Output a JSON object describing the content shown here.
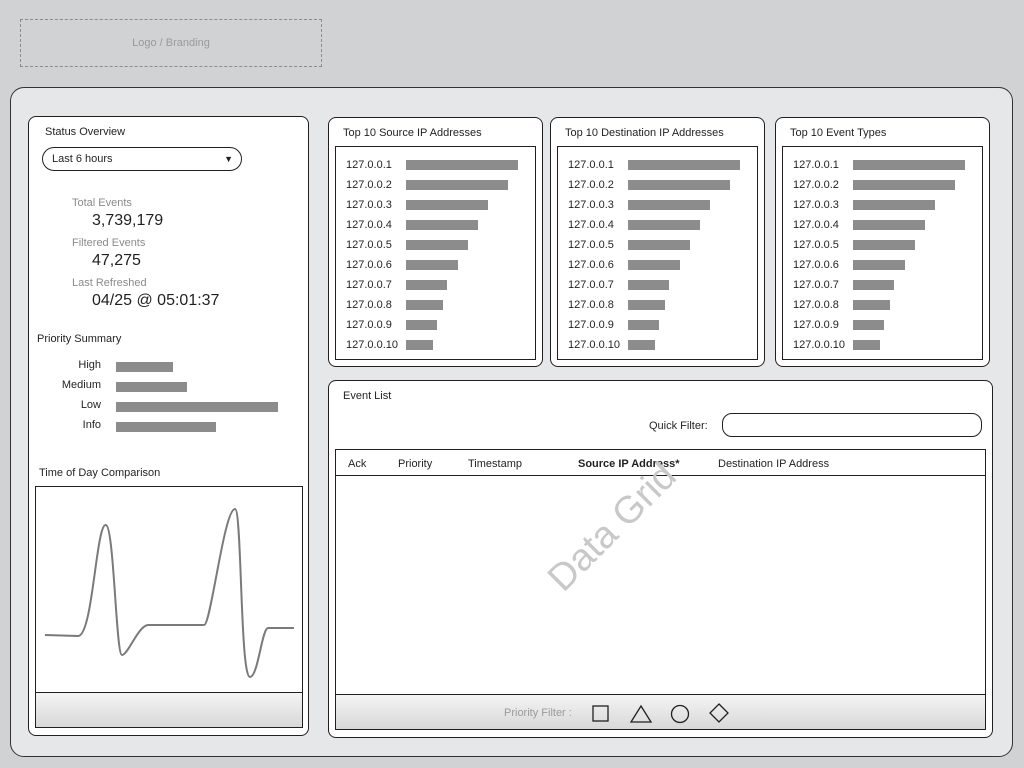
{
  "header": {
    "logo_text": "Logo / Branding"
  },
  "status": {
    "title": "Status Overview",
    "time_range": "Last 6 hours",
    "total_label": "Total Events",
    "total_value": "3,739,179",
    "filtered_label": "Filtered Events",
    "filtered_value": "47,275",
    "refreshed_label": "Last Refreshed",
    "refreshed_value": "04/25 @ 05:01:37"
  },
  "priority": {
    "title": "Priority Summary",
    "items": [
      {
        "label": "High",
        "value": 0.35
      },
      {
        "label": "Medium",
        "value": 0.44
      },
      {
        "label": "Low",
        "value": 1.0
      },
      {
        "label": "Info",
        "value": 0.62
      }
    ]
  },
  "tod": {
    "title": "Time of Day Comparison"
  },
  "top_panels": [
    {
      "title": "Top 10 Source IP Addresses",
      "rows": [
        {
          "label": "127.0.0.1",
          "value": 1.0
        },
        {
          "label": "127.0.0.2",
          "value": 0.91
        },
        {
          "label": "127.0.0.3",
          "value": 0.73
        },
        {
          "label": "127.0.0.4",
          "value": 0.64
        },
        {
          "label": "127.0.0.5",
          "value": 0.55
        },
        {
          "label": "127.0.0.6",
          "value": 0.46
        },
        {
          "label": "127.0.0.7",
          "value": 0.37
        },
        {
          "label": "127.0.0.8",
          "value": 0.33
        },
        {
          "label": "127.0.0.9",
          "value": 0.28
        },
        {
          "label": "127.0.0.10",
          "value": 0.24
        }
      ]
    },
    {
      "title": "Top 10 Destination IP Addresses",
      "rows": [
        {
          "label": "127.0.0.1",
          "value": 1.0
        },
        {
          "label": "127.0.0.2",
          "value": 0.91
        },
        {
          "label": "127.0.0.3",
          "value": 0.73
        },
        {
          "label": "127.0.0.4",
          "value": 0.64
        },
        {
          "label": "127.0.0.5",
          "value": 0.55
        },
        {
          "label": "127.0.0.6",
          "value": 0.46
        },
        {
          "label": "127.0.0.7",
          "value": 0.37
        },
        {
          "label": "127.0.0.8",
          "value": 0.33
        },
        {
          "label": "127.0.0.9",
          "value": 0.28
        },
        {
          "label": "127.0.0.10",
          "value": 0.24
        }
      ]
    },
    {
      "title": "Top 10 Event Types",
      "rows": [
        {
          "label": "127.0.0.1",
          "value": 1.0
        },
        {
          "label": "127.0.0.2",
          "value": 0.91
        },
        {
          "label": "127.0.0.3",
          "value": 0.73
        },
        {
          "label": "127.0.0.4",
          "value": 0.64
        },
        {
          "label": "127.0.0.5",
          "value": 0.55
        },
        {
          "label": "127.0.0.6",
          "value": 0.46
        },
        {
          "label": "127.0.0.7",
          "value": 0.37
        },
        {
          "label": "127.0.0.8",
          "value": 0.33
        },
        {
          "label": "127.0.0.9",
          "value": 0.28
        },
        {
          "label": "127.0.0.10",
          "value": 0.24
        }
      ]
    }
  ],
  "events": {
    "title": "Event List",
    "quick_filter_label": "Quick Filter:",
    "quick_filter_value": "",
    "columns": [
      "Ack",
      "Priority",
      "Timestamp",
      "Source IP Address*",
      "Destination IP Address"
    ],
    "watermark": "Data Grid",
    "priority_filter_label": "Priority Filter :",
    "filter_icons": [
      "square-icon",
      "triangle-icon",
      "circle-icon",
      "diamond-icon"
    ]
  },
  "colors": {
    "bar": "#8c8c8c",
    "background": "#d1d2d4",
    "frame": "#e6e7e8"
  }
}
